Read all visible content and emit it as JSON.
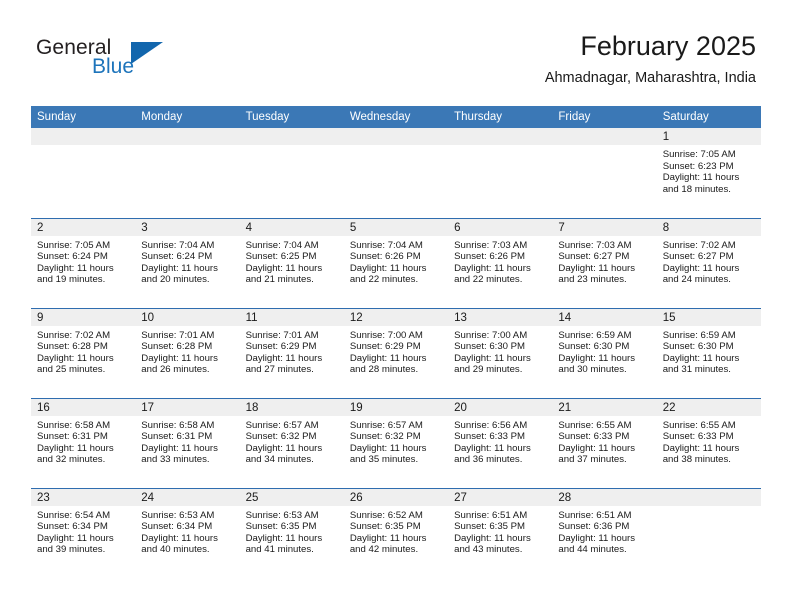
{
  "brand": {
    "name_part1": "General",
    "name_part2": "Blue",
    "logo_icon": "triangle-logo-icon"
  },
  "header": {
    "title": "February 2025",
    "subtitle": "Ahmadnagar, Maharashtra, India"
  },
  "calendar": {
    "weekday_headers": [
      "Sunday",
      "Monday",
      "Tuesday",
      "Wednesday",
      "Thursday",
      "Friday",
      "Saturday"
    ],
    "colors": {
      "header_blue": "#3b78b6",
      "row_border_blue": "#2f6daf",
      "daynum_band": "#efefef",
      "brand_blue": "#1d74bb",
      "text": "#1a1a1a"
    },
    "weeks": [
      [
        {
          "day": ""
        },
        {
          "day": ""
        },
        {
          "day": ""
        },
        {
          "day": ""
        },
        {
          "day": ""
        },
        {
          "day": ""
        },
        {
          "day": "1",
          "sunrise": "Sunrise: 7:05 AM",
          "sunset": "Sunset: 6:23 PM",
          "daylight": "Daylight: 11 hours and 18 minutes."
        }
      ],
      [
        {
          "day": "2",
          "sunrise": "Sunrise: 7:05 AM",
          "sunset": "Sunset: 6:24 PM",
          "daylight": "Daylight: 11 hours and 19 minutes."
        },
        {
          "day": "3",
          "sunrise": "Sunrise: 7:04 AM",
          "sunset": "Sunset: 6:24 PM",
          "daylight": "Daylight: 11 hours and 20 minutes."
        },
        {
          "day": "4",
          "sunrise": "Sunrise: 7:04 AM",
          "sunset": "Sunset: 6:25 PM",
          "daylight": "Daylight: 11 hours and 21 minutes."
        },
        {
          "day": "5",
          "sunrise": "Sunrise: 7:04 AM",
          "sunset": "Sunset: 6:26 PM",
          "daylight": "Daylight: 11 hours and 22 minutes."
        },
        {
          "day": "6",
          "sunrise": "Sunrise: 7:03 AM",
          "sunset": "Sunset: 6:26 PM",
          "daylight": "Daylight: 11 hours and 22 minutes."
        },
        {
          "day": "7",
          "sunrise": "Sunrise: 7:03 AM",
          "sunset": "Sunset: 6:27 PM",
          "daylight": "Daylight: 11 hours and 23 minutes."
        },
        {
          "day": "8",
          "sunrise": "Sunrise: 7:02 AM",
          "sunset": "Sunset: 6:27 PM",
          "daylight": "Daylight: 11 hours and 24 minutes."
        }
      ],
      [
        {
          "day": "9",
          "sunrise": "Sunrise: 7:02 AM",
          "sunset": "Sunset: 6:28 PM",
          "daylight": "Daylight: 11 hours and 25 minutes."
        },
        {
          "day": "10",
          "sunrise": "Sunrise: 7:01 AM",
          "sunset": "Sunset: 6:28 PM",
          "daylight": "Daylight: 11 hours and 26 minutes."
        },
        {
          "day": "11",
          "sunrise": "Sunrise: 7:01 AM",
          "sunset": "Sunset: 6:29 PM",
          "daylight": "Daylight: 11 hours and 27 minutes."
        },
        {
          "day": "12",
          "sunrise": "Sunrise: 7:00 AM",
          "sunset": "Sunset: 6:29 PM",
          "daylight": "Daylight: 11 hours and 28 minutes."
        },
        {
          "day": "13",
          "sunrise": "Sunrise: 7:00 AM",
          "sunset": "Sunset: 6:30 PM",
          "daylight": "Daylight: 11 hours and 29 minutes."
        },
        {
          "day": "14",
          "sunrise": "Sunrise: 6:59 AM",
          "sunset": "Sunset: 6:30 PM",
          "daylight": "Daylight: 11 hours and 30 minutes."
        },
        {
          "day": "15",
          "sunrise": "Sunrise: 6:59 AM",
          "sunset": "Sunset: 6:30 PM",
          "daylight": "Daylight: 11 hours and 31 minutes."
        }
      ],
      [
        {
          "day": "16",
          "sunrise": "Sunrise: 6:58 AM",
          "sunset": "Sunset: 6:31 PM",
          "daylight": "Daylight: 11 hours and 32 minutes."
        },
        {
          "day": "17",
          "sunrise": "Sunrise: 6:58 AM",
          "sunset": "Sunset: 6:31 PM",
          "daylight": "Daylight: 11 hours and 33 minutes."
        },
        {
          "day": "18",
          "sunrise": "Sunrise: 6:57 AM",
          "sunset": "Sunset: 6:32 PM",
          "daylight": "Daylight: 11 hours and 34 minutes."
        },
        {
          "day": "19",
          "sunrise": "Sunrise: 6:57 AM",
          "sunset": "Sunset: 6:32 PM",
          "daylight": "Daylight: 11 hours and 35 minutes."
        },
        {
          "day": "20",
          "sunrise": "Sunrise: 6:56 AM",
          "sunset": "Sunset: 6:33 PM",
          "daylight": "Daylight: 11 hours and 36 minutes."
        },
        {
          "day": "21",
          "sunrise": "Sunrise: 6:55 AM",
          "sunset": "Sunset: 6:33 PM",
          "daylight": "Daylight: 11 hours and 37 minutes."
        },
        {
          "day": "22",
          "sunrise": "Sunrise: 6:55 AM",
          "sunset": "Sunset: 6:33 PM",
          "daylight": "Daylight: 11 hours and 38 minutes."
        }
      ],
      [
        {
          "day": "23",
          "sunrise": "Sunrise: 6:54 AM",
          "sunset": "Sunset: 6:34 PM",
          "daylight": "Daylight: 11 hours and 39 minutes."
        },
        {
          "day": "24",
          "sunrise": "Sunrise: 6:53 AM",
          "sunset": "Sunset: 6:34 PM",
          "daylight": "Daylight: 11 hours and 40 minutes."
        },
        {
          "day": "25",
          "sunrise": "Sunrise: 6:53 AM",
          "sunset": "Sunset: 6:35 PM",
          "daylight": "Daylight: 11 hours and 41 minutes."
        },
        {
          "day": "26",
          "sunrise": "Sunrise: 6:52 AM",
          "sunset": "Sunset: 6:35 PM",
          "daylight": "Daylight: 11 hours and 42 minutes."
        },
        {
          "day": "27",
          "sunrise": "Sunrise: 6:51 AM",
          "sunset": "Sunset: 6:35 PM",
          "daylight": "Daylight: 11 hours and 43 minutes."
        },
        {
          "day": "28",
          "sunrise": "Sunrise: 6:51 AM",
          "sunset": "Sunset: 6:36 PM",
          "daylight": "Daylight: 11 hours and 44 minutes."
        },
        {
          "day": ""
        }
      ]
    ]
  }
}
